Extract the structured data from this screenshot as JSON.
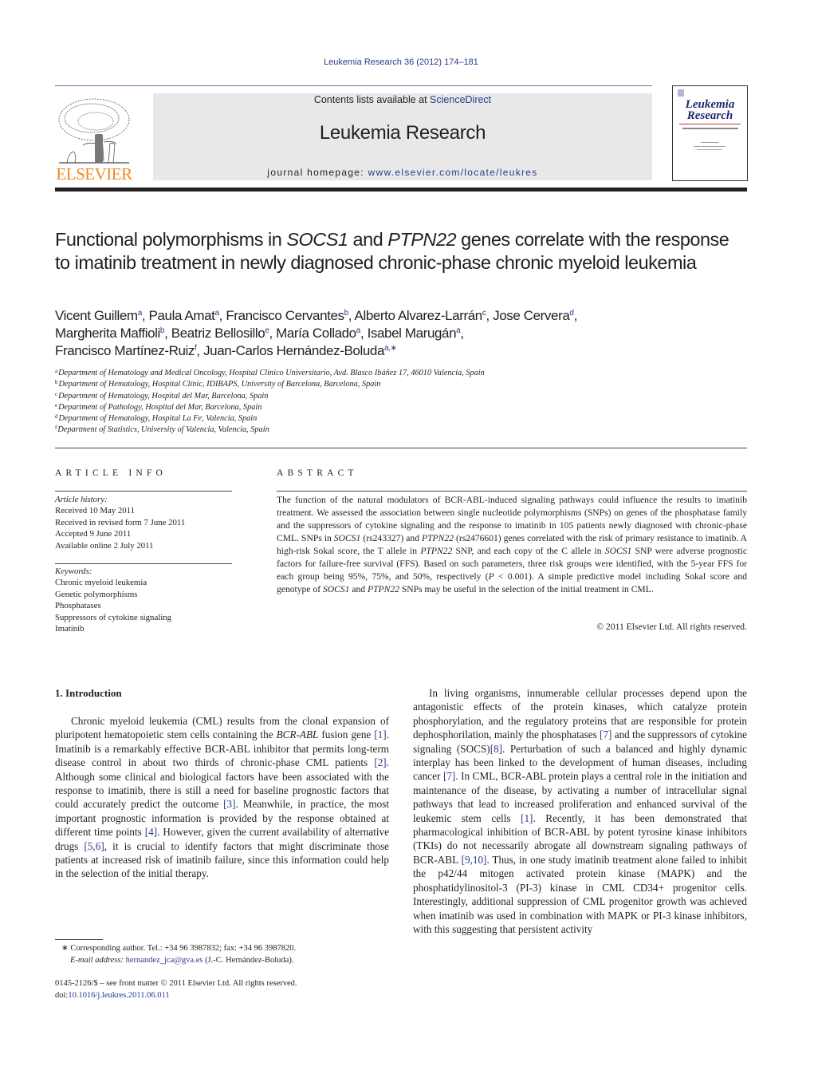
{
  "header": {
    "journal_ref": "Leukemia Research 36 (2012) 174–181",
    "contents_prefix": "Contents lists available at ",
    "contents_link": "ScienceDirect",
    "journal_title": "Leukemia Research",
    "homepage_prefix": "journal homepage: ",
    "homepage_link": "www.elsevier.com/locate/leukres",
    "publisher_logo_text": "ELSEVIER",
    "cover_title_line1": "Leukemia",
    "cover_title_line2": "Research",
    "colors": {
      "link": "#2b3a8c",
      "elsevier_orange": "#f08a24",
      "banner_bg": "#e8e8e8"
    }
  },
  "article": {
    "title_parts": [
      {
        "text": "Functional polymorphisms in ",
        "italic": false
      },
      {
        "text": "SOCS1",
        "italic": true
      },
      {
        "text": " and ",
        "italic": false
      },
      {
        "text": "PTPN22",
        "italic": true
      },
      {
        "text": " genes correlate with the response to imatinib treatment in newly diagnosed chronic-phase chronic myeloid leukemia",
        "italic": false
      }
    ],
    "authors": [
      {
        "name": "Vicent Guillem",
        "aff": "a"
      },
      {
        "name": "Paula Amat",
        "aff": "a"
      },
      {
        "name": "Francisco Cervantes",
        "aff": "b"
      },
      {
        "name": "Alberto Alvarez-Larrán",
        "aff": "c"
      },
      {
        "name": "Jose Cervera",
        "aff": "d"
      },
      {
        "name": "Margherita Maffioli",
        "aff": "b"
      },
      {
        "name": "Beatriz Bellosillo",
        "aff": "e"
      },
      {
        "name": "María Collado",
        "aff": "a"
      },
      {
        "name": "Isabel Marugán",
        "aff": "a"
      },
      {
        "name": "Francisco Martínez-Ruiz",
        "aff": "f"
      },
      {
        "name": "Juan-Carlos Hernández-Boluda",
        "aff": "a,∗"
      }
    ],
    "affiliations": [
      {
        "key": "a",
        "text": "Department of Hematology and Medical Oncology, Hospital Clínico Universitario, Avd. Blasco Ibáñez 17, 46010 Valencia, Spain"
      },
      {
        "key": "b",
        "text": "Department of Hematology, Hospital Clínic, IDIBAPS, University of Barcelona, Barcelona, Spain"
      },
      {
        "key": "c",
        "text": "Department of Hematology, Hospital del Mar, Barcelona, Spain"
      },
      {
        "key": "e",
        "text": "Department of Pathology, Hospital del Mar, Barcelona, Spain"
      },
      {
        "key": "d",
        "text": "Department of Hematology, Hospital La Fe, Valencia, Spain"
      },
      {
        "key": "f",
        "text": "Department of Statistics, University of Valencia, Valencia, Spain"
      }
    ]
  },
  "article_info": {
    "heading": "ARTICLE INFO",
    "history_label": "Article history:",
    "history": [
      "Received 10 May 2011",
      "Received in revised form 7 June 2011",
      "Accepted 9 June 2011",
      "Available online 2 July 2011"
    ],
    "keywords_label": "Keywords:",
    "keywords": [
      "Chronic myeloid leukemia",
      "Genetic polymorphisms",
      "Phosphatases",
      "Suppressors of cytokine signaling",
      "Imatinib"
    ]
  },
  "abstract": {
    "heading": "ABSTRACT",
    "parts": [
      {
        "text": "The function of the natural modulators of BCR-ABL-induced signaling pathways could influence the results to imatinib treatment. We assessed the association between single nucleotide polymorphisms (SNPs) on genes of the phosphatase family and the suppressors of cytokine signaling and the response to imatinib in 105 patients newly diagnosed with chronic-phase CML. SNPs in ",
        "italic": false
      },
      {
        "text": "SOCS1",
        "italic": true
      },
      {
        "text": " (rs243327) and ",
        "italic": false
      },
      {
        "text": "PTPN22",
        "italic": true
      },
      {
        "text": " (rs2476601) genes correlated with the risk of primary resistance to imatinib. A high-risk Sokal score, the T allele in ",
        "italic": false
      },
      {
        "text": "PTPN22",
        "italic": true
      },
      {
        "text": " SNP, and each copy of the C allele in ",
        "italic": false
      },
      {
        "text": "SOCS1",
        "italic": true
      },
      {
        "text": " SNP were adverse prognostic factors for failure-free survival (FFS). Based on such parameters, three risk groups were identified, with the 5-year FFS for each group being 95%, 75%, and 50%, respectively (",
        "italic": false
      },
      {
        "text": "P",
        "italic": true
      },
      {
        "text": " < 0.001). A simple predictive model including Sokal score and genotype of ",
        "italic": false
      },
      {
        "text": "SOCS1",
        "italic": true
      },
      {
        "text": " and ",
        "italic": false
      },
      {
        "text": "PTPN22",
        "italic": true
      },
      {
        "text": " SNPs may be useful in the selection of the initial treatment in CML.",
        "italic": false
      }
    ],
    "copyright": "© 2011 Elsevier Ltd. All rights reserved."
  },
  "body": {
    "section_heading": "1.  Introduction",
    "col1_paragraphs": [
      [
        {
          "t": "Chronic myeloid leukemia (CML) results from the clonal expansion of pluripotent hematopoietic stem cells containing the "
        },
        {
          "t": "BCR-ABL",
          "i": true
        },
        {
          "t": " fusion gene "
        },
        {
          "t": "[1]",
          "c": true
        },
        {
          "t": ". Imatinib is a remarkably effective BCR-ABL inhibitor that permits long-term disease control in about two thirds of chronic-phase CML patients "
        },
        {
          "t": "[2]",
          "c": true
        },
        {
          "t": ". Although some clinical and biological factors have been associated with the response to imatinib, there is still a need for baseline prognostic factors that could accurately predict the outcome "
        },
        {
          "t": "[3]",
          "c": true
        },
        {
          "t": ". Meanwhile, in practice, the most important prognostic information is provided by the response obtained at different time points "
        },
        {
          "t": "[4]",
          "c": true
        },
        {
          "t": ". However, given the current availability of alternative drugs "
        },
        {
          "t": "[5,6]",
          "c": true
        },
        {
          "t": ", it is crucial to identify factors that might discriminate those patients at increased risk of imatinib failure, since this information could help in the selection of the initial therapy."
        }
      ]
    ],
    "col2_paragraphs": [
      [
        {
          "t": "In living organisms, innumerable cellular processes depend upon the antagonistic effects of the protein kinases, which catalyze protein phosphorylation, and the regulatory proteins that are responsible for protein dephosphorilation, mainly the phosphatases "
        },
        {
          "t": "[7]",
          "c": true
        },
        {
          "t": " and the suppressors of cytokine signaling (SOCS)"
        },
        {
          "t": "[8]",
          "c": true
        },
        {
          "t": ". Perturbation of such a balanced and highly dynamic interplay has been linked to the development of human diseases, including cancer "
        },
        {
          "t": "[7]",
          "c": true
        },
        {
          "t": ". In CML, BCR-ABL protein plays a central role in the initiation and maintenance of the disease, by activating a number of intracellular signal pathways that lead to increased proliferation and enhanced survival of the leukemic stem cells "
        },
        {
          "t": "[1]",
          "c": true
        },
        {
          "t": ". Recently, it has been demonstrated that pharmacological inhibition of BCR-ABL by potent tyrosine kinase inhibitors (TKIs) do not necessarily abrogate all downstream signaling pathways of BCR-ABL "
        },
        {
          "t": "[9,10]",
          "c": true
        },
        {
          "t": ". Thus, in one study imatinib treatment alone failed to inhibit the p42/44 mitogen activated protein kinase (MAPK) and the phosphatidylinositol-3 (PI-3) kinase in CML CD34+ progenitor cells. Interestingly, additional suppression of CML progenitor growth was achieved when imatinib was used in combination with MAPK or PI-3 kinase inhibitors, with this suggesting that persistent activity"
        }
      ]
    ]
  },
  "footnotes": {
    "corresponding": "∗  Corresponding author. Tel.: +34 96 3987832; fax: +34 96 3987820.",
    "email_label": "E-mail address: ",
    "email": "hernandez_jca@gva.es",
    "email_suffix": " (J.-C. Hernández-Boluda).",
    "issn_line": "0145-2126/$ – see front matter © 2011 Elsevier Ltd. All rights reserved.",
    "doi_prefix": "doi:",
    "doi": "10.1016/j.leukres.2011.06.011"
  }
}
